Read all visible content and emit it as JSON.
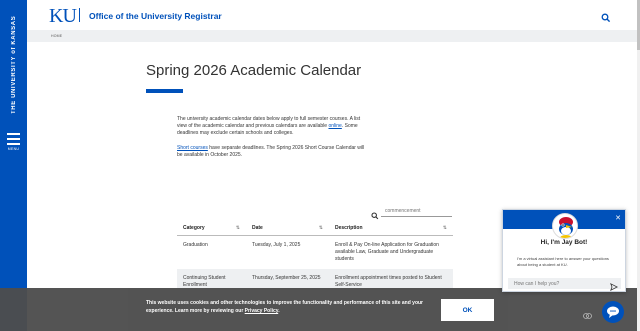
{
  "sidebar": {
    "vertical_title": "THE UNIVERSITY of KANSAS",
    "menu_label": "MENU"
  },
  "header": {
    "logo_text": "KU",
    "site_title": "Office of the University Registrar",
    "search_icon": "search-icon"
  },
  "breadcrumb": {
    "home": "HOME"
  },
  "page": {
    "title": "Spring 2026 Academic Calendar",
    "intro_pre": "The university academic calendar dates below apply to full semester courses. A list view of the academic calendar and previous calendars are available ",
    "intro_link": "online",
    "intro_post": ". Some deadlines may exclude certain schools and colleges.",
    "intro2_link": "Short courses",
    "intro2_post": " have separate deadlines. The Spring 2026 Short Course Calendar will be available in October 2025."
  },
  "table_search": {
    "placeholder": "commencement"
  },
  "table": {
    "headers": [
      "Category",
      "Date",
      "Description"
    ],
    "rows": [
      {
        "category": "Graduation",
        "date": "Tuesday, July 1, 2025",
        "description": "Enroll & Pay On-line Application for Graduation available Law, Graduate and Undergraduate students"
      },
      {
        "category": "Continuing Student Enrollment",
        "date": "Thursday, September 25, 2025",
        "description": "Enrollment appointment times posted to Student Self-Service"
      }
    ]
  },
  "cookie": {
    "text_pre": "This website uses cookies and other technologies to improve the functionality and performance of this site and your experience. Learn more by reviewing our ",
    "link": "Privacy Policy",
    "text_post": ".",
    "ok_label": "OK"
  },
  "chat": {
    "greeting": "Hi, I'm Jay Bot!",
    "description": "I'm a virtual assistant here to answer your questions about being a student at KU.",
    "input_placeholder": "How can I help you?",
    "close_icon": "close-icon",
    "send_icon": "send-icon"
  },
  "colors": {
    "ku_blue": "#0051ba",
    "banner": "#4d4d4d",
    "light_gray": "#eef0f2"
  }
}
